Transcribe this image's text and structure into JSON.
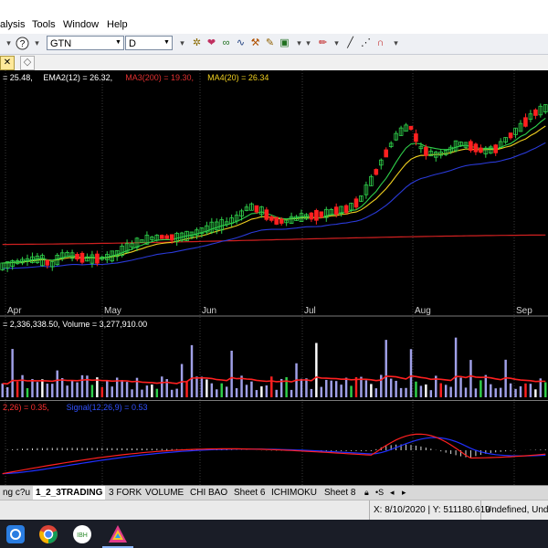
{
  "menu": {
    "items": [
      "alysis",
      "Tools",
      "Window",
      "Help"
    ]
  },
  "toolbar": {
    "symbol": "GTN",
    "interval": "D"
  },
  "chart": {
    "price_legend": [
      {
        "text": "= 25.48,",
        "color": "#ffffff"
      },
      {
        "text": "EMA2(12) = 26.32,",
        "color": "#ffffff"
      },
      {
        "text": "MA3(200) = 19.30,",
        "color": "#e03030"
      },
      {
        "text": "MA4(20) = 26.34",
        "color": "#f0d020"
      }
    ],
    "volume_legend": "= 2,336,338.50, Volume = 3,277,910.00",
    "macd_legend": [
      {
        "text": "2,26) = 0.35,",
        "color": "#ff3030"
      },
      {
        "text": "Signal(12,26,9) = 0.53",
        "color": "#3050ff"
      }
    ],
    "months": [
      "Apr",
      "May",
      "Jun",
      "Jul",
      "Aug",
      "Sep"
    ],
    "colors": {
      "up": "#2fd04a",
      "down": "#ff2020",
      "ema": "#2fd04a",
      "ma20": "#f0d020",
      "ma200": "#d02020",
      "blue": "#2a3ad8",
      "volume": "#a0a0e8",
      "volline": "#ff2020",
      "macd": "#ff2020",
      "signal": "#2030ff"
    }
  },
  "chart_data": {
    "type": "line",
    "title": "GTN",
    "interval": "D",
    "series": [
      {
        "name": "EMA2(12)",
        "last": 26.32
      },
      {
        "name": "MA3(200)",
        "last": 19.3
      },
      {
        "name": "MA4(20)",
        "last": 26.34
      }
    ],
    "close": 25.48,
    "volume": 3277910.0,
    "volume_ma": 2336338.5,
    "macd": 0.35,
    "signal": 0.53,
    "x": [
      "Apr",
      "May",
      "Jun",
      "Jul",
      "Aug",
      "Sep"
    ],
    "price_path": [
      16.2,
      16.6,
      16.9,
      17.0,
      16.4,
      17.6,
      17.3,
      17.0,
      17.1,
      17.4,
      18.2,
      18.9,
      19.3,
      19.5,
      19.4,
      19.6,
      20.1,
      20.6,
      20.9,
      21.6,
      22.9,
      22.4,
      21.3,
      21.2,
      21.6,
      21.8,
      22.0,
      22.4,
      22.6,
      23.6,
      26.0,
      28.6,
      30.9,
      31.9,
      29.2,
      28.6,
      28.9,
      29.9,
      29.6,
      29.0,
      29.3,
      30.6,
      31.7,
      33.2,
      33.8
    ]
  },
  "sheet_tabs": [
    "ng c?u",
    "1_2_3TRADING",
    "3 FORK",
    "VOLUME",
    "CHI BAO",
    "Sheet 6",
    "ICHIMOKU",
    "Sheet 8"
  ],
  "status": {
    "coords": "X: 8/10/2020 | Y: 511180.619",
    "mode": "Undefined, Unde"
  }
}
